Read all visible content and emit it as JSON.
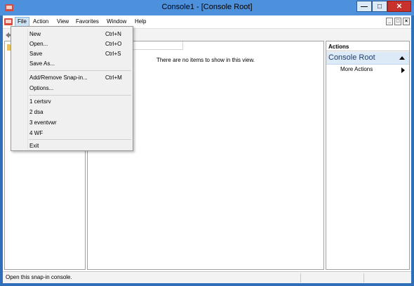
{
  "window": {
    "title": "Console1 - [Console Root]"
  },
  "menubar": {
    "items": [
      "File",
      "Action",
      "View",
      "Favorites",
      "Window",
      "Help"
    ]
  },
  "file_menu": {
    "groups": [
      [
        {
          "label": "New",
          "shortcut": "Ctrl+N"
        },
        {
          "label": "Open...",
          "shortcut": "Ctrl+O"
        },
        {
          "label": "Save",
          "shortcut": "Ctrl+S"
        },
        {
          "label": "Save As...",
          "shortcut": ""
        }
      ],
      [
        {
          "label": "Add/Remove Snap-in...",
          "shortcut": "Ctrl+M"
        },
        {
          "label": "Options...",
          "shortcut": ""
        }
      ],
      [
        {
          "label": "1 certsrv",
          "shortcut": ""
        },
        {
          "label": "2 dsa",
          "shortcut": ""
        },
        {
          "label": "3 eventvwr",
          "shortcut": ""
        },
        {
          "label": "4 WF",
          "shortcut": ""
        }
      ],
      [
        {
          "label": "Exit",
          "shortcut": ""
        }
      ]
    ]
  },
  "result_pane": {
    "empty_message": "There are no items to show in this view."
  },
  "actions_pane": {
    "header": "Actions",
    "section": "Console Root",
    "items": [
      "More Actions"
    ]
  },
  "statusbar": {
    "text": "Open this snap-in console."
  },
  "colors": {
    "titlebar": "#4d90dc",
    "frame": "#2f6fba",
    "close_button": "#c7322d",
    "menu_highlight": "#cce4f7",
    "actions_section": "#dce9f7"
  },
  "icons": [
    "mmc-app-icon",
    "mmc-doc-icon",
    "back-arrow-icon",
    "folder-icon",
    "collapse-icon",
    "submenu-arrow-icon"
  ]
}
